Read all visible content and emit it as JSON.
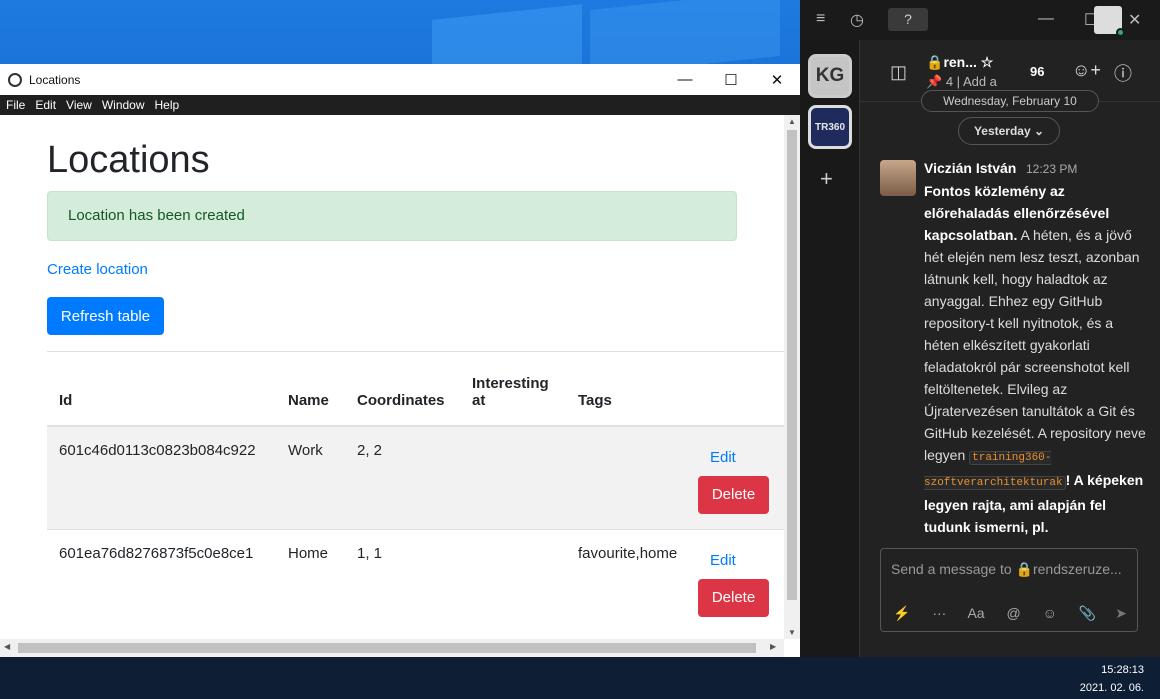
{
  "electron_window": {
    "title": "Locations",
    "menu": [
      "File",
      "Edit",
      "View",
      "Window",
      "Help"
    ],
    "page": {
      "heading": "Locations",
      "alert": "Location has been created",
      "create_link": "Create location",
      "refresh_button": "Refresh table",
      "table": {
        "headers": [
          "Id",
          "Name",
          "Coordinates",
          "Interesting at",
          "Tags"
        ],
        "rows": [
          {
            "id": "601c46d0113c0823b084c922",
            "name": "Work",
            "coordinates": "2, 2",
            "interesting_at": "",
            "tags": "",
            "edit": "Edit",
            "delete": "Delete"
          },
          {
            "id": "601ea76d8276873f5c0e8ce1",
            "name": "Home",
            "coordinates": "1, 1",
            "interesting_at": "",
            "tags": "favourite,home",
            "edit": "Edit",
            "delete": "Delete"
          }
        ]
      }
    }
  },
  "chat": {
    "teams": [
      {
        "label": "KG"
      },
      {
        "label": "TR360"
      }
    ],
    "channel": {
      "name": "ren...",
      "pinned_count": "4",
      "add_label": "Add a",
      "member_count": "96"
    },
    "old_date": "Wednesday, February 10",
    "date_separator": "Yesterday",
    "message": {
      "author": "Viczián István",
      "time": "12:23 PM",
      "bold_text": "Fontos közlemény az előrehaladás ellenőrzésével kapcsolatban.",
      "text_1": " A héten, és a jövő hét elején nem lesz teszt, azonban látnunk kell, hogy haladtok az anyaggal. Ehhez egy GitHub repository-t kell nyitnotok, és a héten elkészített gyakorlati feladatokról pár screenshotot kell feltöltenetek. Elvileg az Újratervezésen tanultátok a Git és GitHub kezelését. A repository neve legyen ",
      "code": "training360-szoftverarchitekturak",
      "text_2": "! A képeken legyen rajta, ami alapján fel tudunk ismerni, pl."
    },
    "composer_placeholder": "Send a message to 🔒rendszeruze..."
  },
  "taskbar": {
    "time": "15:28:13",
    "date": "2021. 02. 06."
  }
}
